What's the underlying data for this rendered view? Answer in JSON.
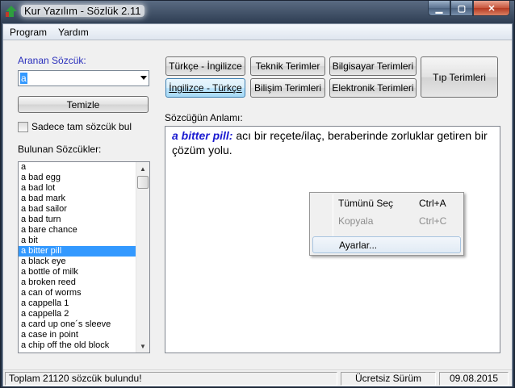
{
  "window": {
    "title": "Kur Yazılım - Sözlük 2.11"
  },
  "menu": [
    "Program",
    "Yardım"
  ],
  "search": {
    "label": "Aranan Sözcük:",
    "value": "a"
  },
  "clear_button": "Temizle",
  "exact_match_label": "Sadece tam sözcük bul",
  "found_words_label": "Bulunan Sözcükler:",
  "words": [
    "a",
    "a bad egg",
    "a bad lot",
    "a bad mark",
    "a bad sailor",
    "a bad turn",
    "a bare chance",
    "a bit",
    "a bitter pill",
    "a black eye",
    "a bottle of milk",
    "a broken reed",
    "a can of worms",
    "a cappella 1",
    "a cappella 2",
    "a card up one´s sleeve",
    "a case in point",
    "a chip off the old block"
  ],
  "selected_word_index": 8,
  "dictionaries": {
    "tr_en": "Türkçe - İngilizce",
    "en_tr": "İngilizce - Türkçe",
    "technical": "Teknik Terimler",
    "informatics": "Bilişim Terimleri",
    "computer": "Bilgisayar Terimleri",
    "electronic": "Elektronik Terimleri",
    "medical": "Tıp Terimleri"
  },
  "meaning": {
    "label": "Sözcüğün Anlamı:",
    "term": "a bitter pill:",
    "definition": " acı bir reçete/ilaç, beraberinde zorluklar getiren bir çözüm yolu."
  },
  "context_menu": {
    "select_all": "Tümünü Seç",
    "select_all_key": "Ctrl+A",
    "copy": "Kopyala",
    "copy_key": "Ctrl+C",
    "settings": "Ayarlar..."
  },
  "status": {
    "count": "Toplam 21120 sözcük bulundu!",
    "edition": "Ücretsiz Sürüm",
    "date": "09.08.2015"
  },
  "colors": {
    "selection": "#3399ff",
    "term": "#1a1ad0",
    "label_accent": "#2a2fbc"
  }
}
